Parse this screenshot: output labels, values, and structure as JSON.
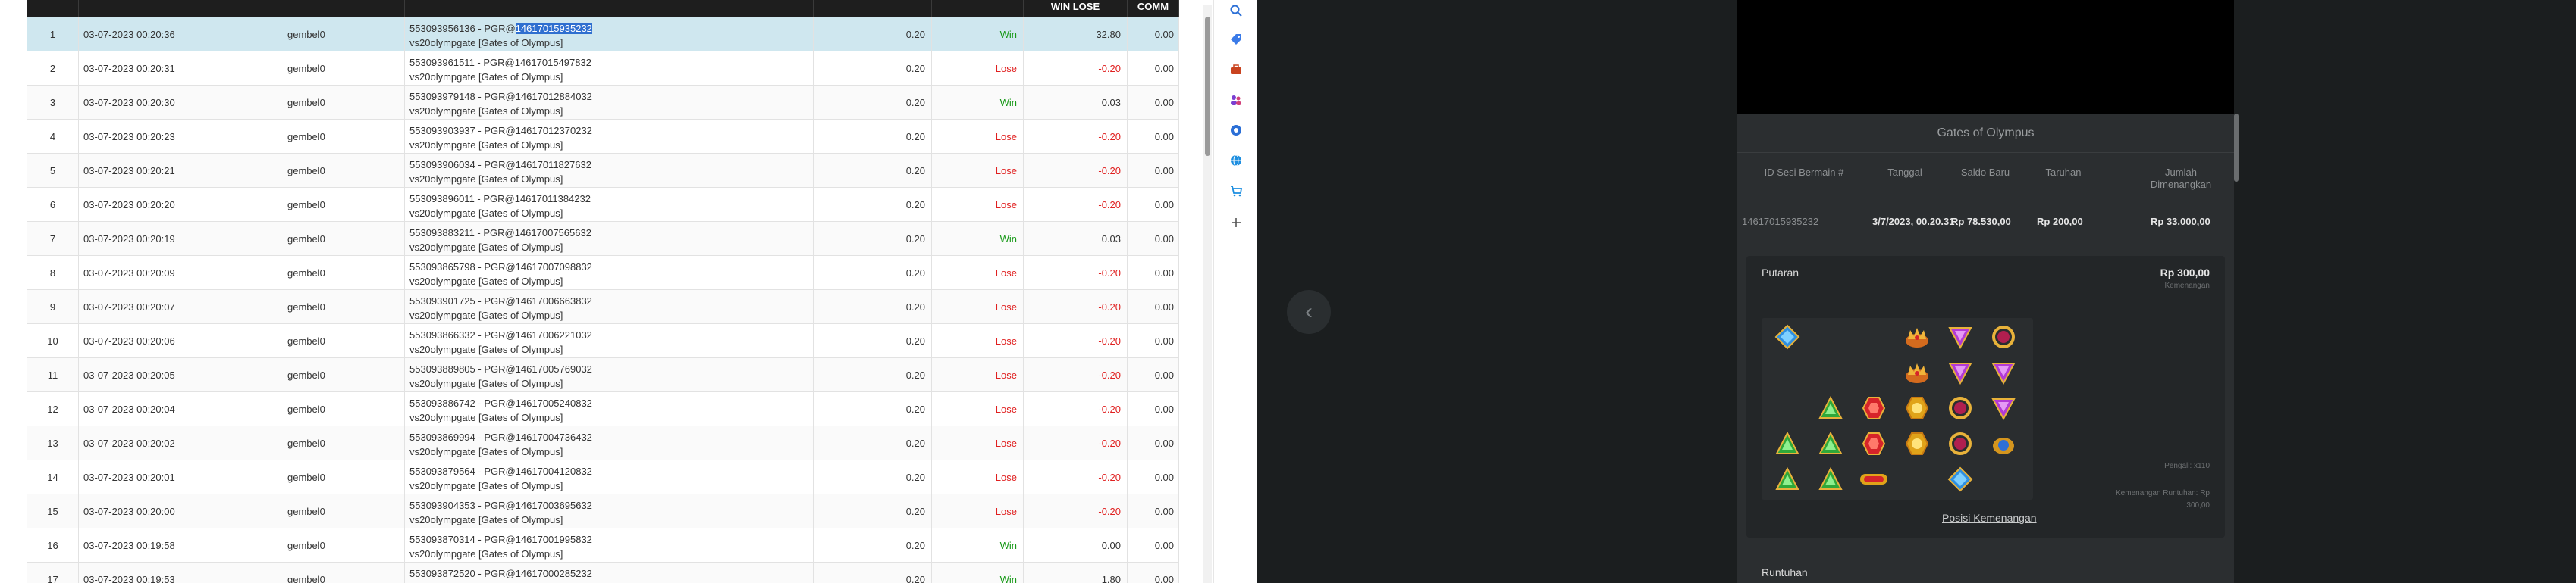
{
  "table": {
    "headers": [
      "WIN LOSE",
      "COMM"
    ],
    "rows": [
      {
        "no": "1",
        "date": "03-07-2023 00:20:36",
        "user": "gembel0",
        "desc_pre": "553093956136 - PGR@",
        "desc_hl": "14617015935232",
        "desc_line2": "vs20olympgate [Gates of Olympus]",
        "bet": "0.20",
        "result": "Win",
        "winlose": "32.80",
        "comm": "0.00"
      },
      {
        "no": "2",
        "date": "03-07-2023 00:20:31",
        "user": "gembel0",
        "desc_pre": "553093961511 - PGR@14617015497832",
        "desc_hl": "",
        "desc_line2": "vs20olympgate [Gates of Olympus]",
        "bet": "0.20",
        "result": "Lose",
        "winlose": "-0.20",
        "comm": "0.00"
      },
      {
        "no": "3",
        "date": "03-07-2023 00:20:30",
        "user": "gembel0",
        "desc_pre": "553093979148 - PGR@14617012884032",
        "desc_hl": "",
        "desc_line2": "vs20olympgate [Gates of Olympus]",
        "bet": "0.20",
        "result": "Win",
        "winlose": "0.03",
        "comm": "0.00"
      },
      {
        "no": "4",
        "date": "03-07-2023 00:20:23",
        "user": "gembel0",
        "desc_pre": "553093903937 - PGR@14617012370232",
        "desc_hl": "",
        "desc_line2": "vs20olympgate [Gates of Olympus]",
        "bet": "0.20",
        "result": "Lose",
        "winlose": "-0.20",
        "comm": "0.00"
      },
      {
        "no": "5",
        "date": "03-07-2023 00:20:21",
        "user": "gembel0",
        "desc_pre": "553093906034 - PGR@14617011827632",
        "desc_hl": "",
        "desc_line2": "vs20olympgate [Gates of Olympus]",
        "bet": "0.20",
        "result": "Lose",
        "winlose": "-0.20",
        "comm": "0.00"
      },
      {
        "no": "6",
        "date": "03-07-2023 00:20:20",
        "user": "gembel0",
        "desc_pre": "553093896011 - PGR@14617011384232",
        "desc_hl": "",
        "desc_line2": "vs20olympgate [Gates of Olympus]",
        "bet": "0.20",
        "result": "Lose",
        "winlose": "-0.20",
        "comm": "0.00"
      },
      {
        "no": "7",
        "date": "03-07-2023 00:20:19",
        "user": "gembel0",
        "desc_pre": "553093883211 - PGR@14617007565632",
        "desc_hl": "",
        "desc_line2": "vs20olympgate [Gates of Olympus]",
        "bet": "0.20",
        "result": "Win",
        "winlose": "0.03",
        "comm": "0.00"
      },
      {
        "no": "8",
        "date": "03-07-2023 00:20:09",
        "user": "gembel0",
        "desc_pre": "553093865798 - PGR@14617007098832",
        "desc_hl": "",
        "desc_line2": "vs20olympgate [Gates of Olympus]",
        "bet": "0.20",
        "result": "Lose",
        "winlose": "-0.20",
        "comm": "0.00"
      },
      {
        "no": "9",
        "date": "03-07-2023 00:20:07",
        "user": "gembel0",
        "desc_pre": "553093901725 - PGR@14617006663832",
        "desc_hl": "",
        "desc_line2": "vs20olympgate [Gates of Olympus]",
        "bet": "0.20",
        "result": "Lose",
        "winlose": "-0.20",
        "comm": "0.00"
      },
      {
        "no": "10",
        "date": "03-07-2023 00:20:06",
        "user": "gembel0",
        "desc_pre": "553093866332 - PGR@14617006221032",
        "desc_hl": "",
        "desc_line2": "vs20olympgate [Gates of Olympus]",
        "bet": "0.20",
        "result": "Lose",
        "winlose": "-0.20",
        "comm": "0.00"
      },
      {
        "no": "11",
        "date": "03-07-2023 00:20:05",
        "user": "gembel0",
        "desc_pre": "553093889805 - PGR@14617005769032",
        "desc_hl": "",
        "desc_line2": "vs20olympgate [Gates of Olympus]",
        "bet": "0.20",
        "result": "Lose",
        "winlose": "-0.20",
        "comm": "0.00"
      },
      {
        "no": "12",
        "date": "03-07-2023 00:20:04",
        "user": "gembel0",
        "desc_pre": "553093886742 - PGR@14617005240832",
        "desc_hl": "",
        "desc_line2": "vs20olympgate [Gates of Olympus]",
        "bet": "0.20",
        "result": "Lose",
        "winlose": "-0.20",
        "comm": "0.00"
      },
      {
        "no": "13",
        "date": "03-07-2023 00:20:02",
        "user": "gembel0",
        "desc_pre": "553093869994 - PGR@14617004736432",
        "desc_hl": "",
        "desc_line2": "vs20olympgate [Gates of Olympus]",
        "bet": "0.20",
        "result": "Lose",
        "winlose": "-0.20",
        "comm": "0.00"
      },
      {
        "no": "14",
        "date": "03-07-2023 00:20:01",
        "user": "gembel0",
        "desc_pre": "553093879564 - PGR@14617004120832",
        "desc_hl": "",
        "desc_line2": "vs20olympgate [Gates of Olympus]",
        "bet": "0.20",
        "result": "Lose",
        "winlose": "-0.20",
        "comm": "0.00"
      },
      {
        "no": "15",
        "date": "03-07-2023 00:20:00",
        "user": "gembel0",
        "desc_pre": "553093904353 - PGR@14617003695632",
        "desc_hl": "",
        "desc_line2": "vs20olympgate [Gates of Olympus]",
        "bet": "0.20",
        "result": "Lose",
        "winlose": "-0.20",
        "comm": "0.00"
      },
      {
        "no": "16",
        "date": "03-07-2023 00:19:58",
        "user": "gembel0",
        "desc_pre": "553093870314 - PGR@14617001995832",
        "desc_hl": "",
        "desc_line2": "vs20olympgate [Gates of Olympus]",
        "bet": "0.20",
        "result": "Win",
        "winlose": "0.00",
        "comm": "0.00"
      },
      {
        "no": "17",
        "date": "03-07-2023 00:19:53",
        "user": "gembel0",
        "desc_pre": "553093872520 - PGR@14617000285232",
        "desc_hl": "",
        "desc_line2": "",
        "bet": "0.20",
        "result": "Win",
        "winlose": "1.80",
        "comm": "0.00"
      }
    ]
  },
  "sidebar_icons": [
    "search-icon",
    "tag-icon",
    "briefcase-icon",
    "people-icon",
    "gear-circle-icon",
    "globe-icon",
    "cart-icon",
    "plus-icon"
  ],
  "game": {
    "title": "Gates of Olympus",
    "headers": {
      "session": "ID Sesi Bermain #",
      "date": "Tanggal",
      "balance": "Saldo Baru",
      "bet": "Taruhan",
      "win_l1": "Jumlah",
      "win_l2": "Dimenangkan"
    },
    "values": {
      "session": "14617015935232",
      "date": "3/7/2023, 00.20.31",
      "balance": "Rp 78.530,00",
      "bet": "Rp 200,00",
      "win": "Rp 33.000,00"
    },
    "round": {
      "title": "Putaran",
      "amount": "Rp 300,00",
      "amount_label": "Kemenangan",
      "multiplier_label": "Pengali: x110",
      "tumble_l1": "Kemenangan Runtuhan: Rp",
      "tumble_l2": "300,00",
      "position_link": "Posisi Kemenangan"
    },
    "runtuhan": "Runtuhan",
    "board": [
      [
        "gem-blue",
        "",
        "",
        "crown",
        "gem-purple",
        "ring"
      ],
      [
        "",
        "",
        "",
        "crown",
        "gem-purple",
        "gem-purple"
      ],
      [
        "",
        "gem-green",
        "gem-red",
        "gem-yellow",
        "ring",
        "gem-purple"
      ],
      [
        "gem-green",
        "gem-green",
        "gem-red",
        "gem-yellow",
        "ring",
        "crown-blue"
      ],
      [
        "gem-green",
        "gem-green",
        "hourglass",
        "",
        "gem-blue",
        ""
      ]
    ]
  },
  "colors": {
    "win": "#1a9a1a",
    "lose": "#e02020",
    "header": "#1e1e1e",
    "selected": "#cfe7ef",
    "game_bg": "#1b1e1f"
  }
}
